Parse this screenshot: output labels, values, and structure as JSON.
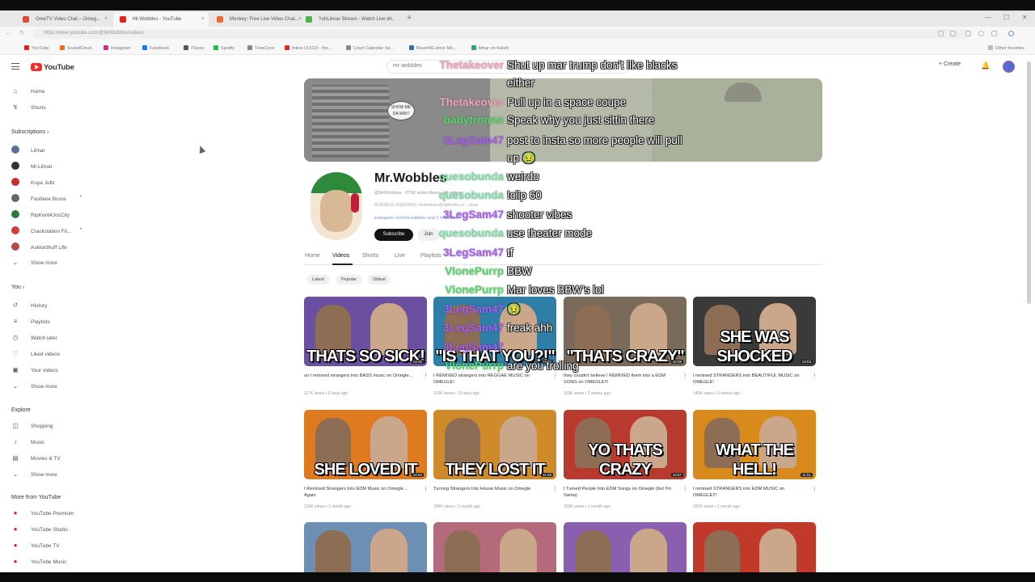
{
  "browser": {
    "tabs": [
      {
        "label": "OmeTV Video Chat – Omeg...",
        "color": "#e04a3a"
      },
      {
        "label": "Mr.Wobbles - YouTube",
        "color": "#e62020"
      },
      {
        "label": "Monkey: Free Live Video Chat...",
        "color": "#ef6a2a"
      },
      {
        "label": "YuhLilmar Stream - Watch Live on...",
        "color": "#4fb04f"
      }
    ],
    "new_tab": "+",
    "url": "https://www.youtube.com/@MrWobbles/videos",
    "bookmarks": [
      {
        "label": "YouTube",
        "color": "#e62020"
      },
      {
        "label": "SoundCloud",
        "color": "#f26a1b"
      },
      {
        "label": "Instagram",
        "color": "#c13584"
      },
      {
        "label": "Facebook",
        "color": "#1877f2"
      },
      {
        "label": "iTunes",
        "color": "#555555"
      },
      {
        "label": "Spotify",
        "color": "#1db954"
      },
      {
        "label": "TuneCore",
        "color": "#888888"
      },
      {
        "label": "Inbox (3,912) - the...",
        "color": "#d93025"
      },
      {
        "label": "Court Calendar Se...",
        "color": "#8a8a8a"
      },
      {
        "label": "BeamNG.drive Mo...",
        "color": "#3b6ea5"
      },
      {
        "label": "lilmar on Kalshi",
        "color": "#2fa36b"
      }
    ],
    "other_favorites": "Other favorites"
  },
  "youtube": {
    "logo_text": "YouTube",
    "search_value": "mr wobbles",
    "create_label": "Create",
    "accent": "#ff0000"
  },
  "sidebar": {
    "top": [
      {
        "label": "Home",
        "icon": "home-icon",
        "glyph": "⌂"
      },
      {
        "label": "Shorts",
        "icon": "shorts-icon",
        "glyph": "↯"
      }
    ],
    "subscriptions_title": "Subscriptions",
    "subscriptions": [
      {
        "label": "Lilmar",
        "color": "#5a6f9a",
        "live": false
      },
      {
        "label": "Mr.Lilmar",
        "color": "#333333",
        "live": false
      },
      {
        "label": "Kuya Jullz",
        "color": "#c9302c",
        "live": false
      },
      {
        "label": "Fastlane Bruce",
        "color": "#666666",
        "live": true
      },
      {
        "label": "RipKent4JocCity",
        "color": "#2a7a3a",
        "live": false
      },
      {
        "label": "Crackstation Fil...",
        "color": "#d63a3a",
        "live": true
      },
      {
        "label": "Asklordhuff Life",
        "color": "#b34a4a",
        "live": false
      }
    ],
    "show_more": "Show more",
    "you_title": "You",
    "you": [
      {
        "label": "History",
        "icon": "history-icon",
        "glyph": "↺"
      },
      {
        "label": "Playlists",
        "icon": "playlists-icon",
        "glyph": "≡"
      },
      {
        "label": "Watch later",
        "icon": "watch-later-icon",
        "glyph": "◷"
      },
      {
        "label": "Liked videos",
        "icon": "like-icon",
        "glyph": "♡"
      },
      {
        "label": "Your videos",
        "icon": "your-videos-icon",
        "glyph": "▣"
      }
    ],
    "explore_title": "Explore",
    "explore": [
      {
        "label": "Shopping",
        "icon": "shopping-icon",
        "glyph": "◫"
      },
      {
        "label": "Music",
        "icon": "music-icon",
        "glyph": "♪"
      },
      {
        "label": "Movies & TV",
        "icon": "movies-icon",
        "glyph": "▤"
      }
    ],
    "more_title": "More from YouTube",
    "more": [
      {
        "label": "YouTube Premium",
        "color": "#e62020"
      },
      {
        "label": "YouTube Studio",
        "color": "#e62020"
      },
      {
        "label": "YouTube TV",
        "color": "#e62020"
      },
      {
        "label": "YouTube Music",
        "color": "#e62020"
      }
    ]
  },
  "channel": {
    "banner_bubble": "SHOW ME DA WAY!",
    "name": "Mr.Wobbles",
    "handle": "@MrWobbles · 879K subscribers · 96 videos",
    "business": "BUSINESS INQUIRIES: mrwobbles@nightclick.co ...more",
    "link": "instagram.com/mrwobbles and 1 more link",
    "subscribe": "Subscribe",
    "join": "Join",
    "tabs": [
      "Home",
      "Videos",
      "Shorts",
      "Live",
      "Playlists"
    ],
    "active_tab": "Videos",
    "chips": [
      "Latest",
      "Popular",
      "Oldest"
    ]
  },
  "videos": [
    {
      "caption": "THATS SO SICK!",
      "duration": "14:46",
      "title": "so I remixed strangers into BASS music on Omegle...",
      "meta": "117K views • 5 days ago",
      "bg": "#6b4fa0",
      "cap_color": "#ffffff"
    },
    {
      "caption": "\"IS THAT YOU?!\"",
      "duration": "13:02",
      "title": "I REMIXED strangers into REGGAE MUSIC on OMEGLE!",
      "meta": "110K views • 13 days ago",
      "bg": "#2e7ea8",
      "cap_color": "#ffffff"
    },
    {
      "caption": "\"THATS CRAZY\"",
      "duration": "18:09",
      "title": "they couldn't believe I REMIXED them into a EDM SONG on OMEGLE!!!",
      "meta": "110K views • 2 weeks ago",
      "bg": "#7a6a5a",
      "cap_color": "#ffffff"
    },
    {
      "caption": "SHE WAS SHOCKED",
      "duration": "12:53",
      "title": "I remixed STRANGERS into BEAUTIFUL MUSIC on OMEGLE!",
      "meta": "140K views • 3 weeks ago",
      "bg": "#3a3a3a",
      "cap_color": "#ffffff"
    },
    {
      "caption": "SHE LOVED IT",
      "duration": "10:03",
      "title": "I Remixed Strangers Into EDM Music on Omegle... Again",
      "meta": "126K views • 1 month ago",
      "bg": "#e07a1f",
      "cap_color": "#ffffff"
    },
    {
      "caption": "THEY LOST IT",
      "duration": "11:35",
      "title": "Turning Strangers Into House Music on Omegle",
      "meta": "196K views • 1 month ago",
      "bg": "#cf8a2a",
      "cap_color": "#ffffff"
    },
    {
      "caption": "YO THATS CRAZY",
      "duration": "10:57",
      "title": "I Turned People Into EDM Songs on Omegle (but I'm Santa)",
      "meta": "163K views • 1 month ago",
      "bg": "#b8392e",
      "cap_color": "#ffffff"
    },
    {
      "caption": "WHAT THE HELL!",
      "duration": "11:51",
      "title": "I remixed STRANGERS into EDM MUSIC on OMEGLE!!!",
      "meta": "331K views • 1 month ago",
      "bg": "#d88a1a",
      "cap_color": "#ffffff"
    },
    {
      "caption": "",
      "duration": "",
      "title": "",
      "meta": "",
      "bg": "#6d8fb3",
      "cap_color": "#ffffff"
    },
    {
      "caption": "",
      "duration": "",
      "title": "",
      "meta": "",
      "bg": "#b46a7a",
      "cap_color": "#ffffff"
    },
    {
      "caption": "",
      "duration": "",
      "title": "",
      "meta": "",
      "bg": "#8a5fb0",
      "cap_color": "#ffffff"
    },
    {
      "caption": "",
      "duration": "",
      "title": "",
      "meta": "",
      "bg": "#c0392b",
      "cap_color": "#ffffff"
    }
  ],
  "chat": [
    {
      "user": "Thetakeover",
      "color": "#f3a3b8",
      "text": "Shut up mar trump don't like blacks either"
    },
    {
      "user": "Thetakeover",
      "color": "#f3a3b8",
      "text": "Pull up in a space coupe"
    },
    {
      "user": "babytronnn",
      "color": "#58d66a",
      "text": "Speak why you just sittin there"
    },
    {
      "user": "3LegSam47",
      "color": "#a85cf0",
      "text": "post to insta so more people will pull up 🤢"
    },
    {
      "user": "quesobunda",
      "color": "#7ee0a8",
      "text": "weirdo"
    },
    {
      "user": "quesobunda",
      "color": "#7ee0a8",
      "text": "!clip 60"
    },
    {
      "user": "3LegSam47",
      "color": "#a85cf0",
      "text": "shooter vibes"
    },
    {
      "user": "quesobunda",
      "color": "#7ee0a8",
      "text": "use theater mode"
    },
    {
      "user": "3LegSam47",
      "color": "#a85cf0",
      "text": "tf"
    },
    {
      "user": "VlonePurrp",
      "color": "#58d66a",
      "text": "BBW"
    },
    {
      "user": "VlonePurrp",
      "color": "#58d66a",
      "text": "Mar loves BBW's lol"
    },
    {
      "user": "3LegSam47",
      "color": "#a85cf0",
      "text": "🤢"
    },
    {
      "user": "3LegSam47",
      "color": "#a85cf0",
      "text": "freak ahh"
    },
    {
      "user": "3LegSam47",
      "color": "#a85cf0",
      "text": ""
    },
    {
      "user": "VlonePurrp",
      "color": "#58d66a",
      "text": "are you trolling"
    }
  ]
}
